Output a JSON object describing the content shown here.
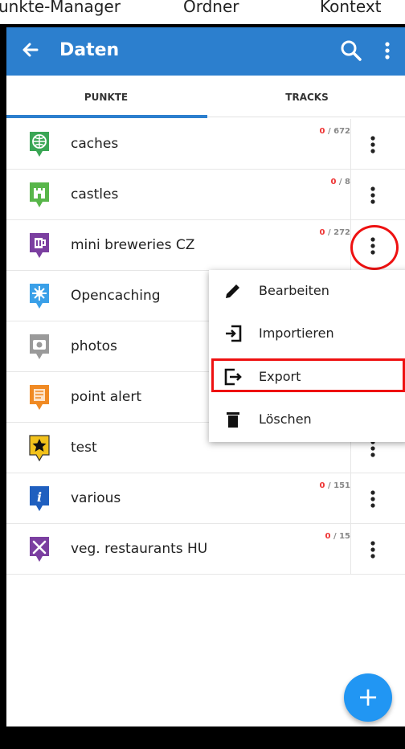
{
  "caption": {
    "left": "unkte-Manager",
    "middle": "Ordner",
    "right": "Kontext"
  },
  "appbar": {
    "title": "Daten",
    "color": "#2c7fce"
  },
  "tabs": [
    {
      "label": "PUNKTE",
      "selected": true
    },
    {
      "label": "TRACKS",
      "selected": false
    }
  ],
  "folders": [
    {
      "name": "caches",
      "count_a": "0",
      "count_b": "/ 672",
      "icon": "globe-pin-icon",
      "color": "#3aa655"
    },
    {
      "name": "castles",
      "count_a": "0",
      "count_b": "/ 8",
      "icon": "castle-pin-icon",
      "color": "#58b64a"
    },
    {
      "name": "mini breweries CZ",
      "count_a": "0",
      "count_b": "/ 272",
      "icon": "beer-pin-icon",
      "color": "#7b3fa0"
    },
    {
      "name": "Opencaching",
      "count_a": "",
      "count_b": "",
      "icon": "star-burst-pin-icon",
      "color": "#3aa0e8"
    },
    {
      "name": "photos",
      "count_a": "",
      "count_b": "",
      "icon": "camera-pin-icon",
      "color": "#9a9a9a"
    },
    {
      "name": "point alert",
      "count_a": "",
      "count_b": "",
      "icon": "alert-pin-icon",
      "color": "#f08a24"
    },
    {
      "name": "test",
      "count_a": "",
      "count_b": "",
      "icon": "star-pin-icon",
      "color": "#f2c21b"
    },
    {
      "name": "various",
      "count_a": "0",
      "count_b": "/ 151",
      "icon": "info-pin-icon",
      "color": "#1f5fbf"
    },
    {
      "name": "veg. restaurants HU",
      "count_a": "0",
      "count_b": "/ 15",
      "icon": "cutlery-pin-icon",
      "color": "#7b3fa0"
    }
  ],
  "context_menu": [
    {
      "label": "Bearbeiten",
      "icon": "pencil-icon"
    },
    {
      "label": "Importieren",
      "icon": "import-icon"
    },
    {
      "label": "Export",
      "icon": "export-icon"
    },
    {
      "label": "Löschen",
      "icon": "trash-icon"
    }
  ],
  "fab": {
    "label": "+"
  }
}
